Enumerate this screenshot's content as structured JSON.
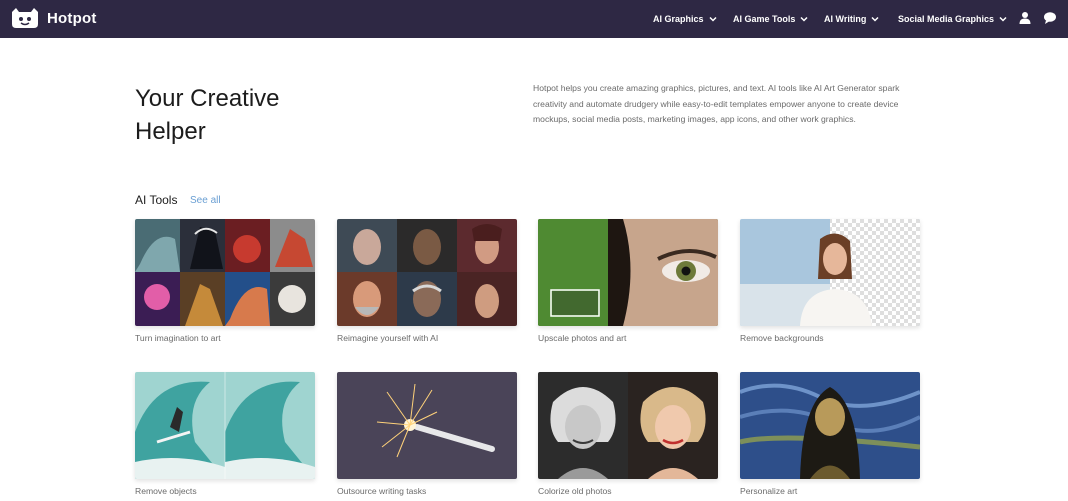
{
  "brand": {
    "name": "Hotpot"
  },
  "nav": {
    "menus": [
      {
        "label": "AI Graphics"
      },
      {
        "label": "AI Game Tools"
      },
      {
        "label": "AI Writing"
      },
      {
        "label": "Social Media Graphics"
      }
    ],
    "icons": [
      "user-icon",
      "chat-icon"
    ]
  },
  "hero": {
    "title_line1": "Your Creative",
    "title_line2": "Helper",
    "description": "Hotpot helps you create amazing graphics, pictures, and text. AI tools like AI Art Generator spark creativity and automate drudgery while easy-to-edit templates empower anyone to create device mockups, social media posts, marketing images, app icons, and other work graphics."
  },
  "section": {
    "title": "AI Tools",
    "see_all": "See all"
  },
  "tools": [
    {
      "label": "Turn imagination to art"
    },
    {
      "label": "Reimagine yourself with AI"
    },
    {
      "label": "Upscale photos and art"
    },
    {
      "label": "Remove backgrounds"
    },
    {
      "label": "Remove objects"
    },
    {
      "label": "Outsource writing tasks"
    },
    {
      "label": "Colorize old photos"
    },
    {
      "label": "Personalize art"
    }
  ],
  "colors": {
    "nav_bg": "#2e2844",
    "link": "#6a9fd3",
    "text_dark": "#1c1c1c",
    "text_muted": "#6b6b6b"
  }
}
